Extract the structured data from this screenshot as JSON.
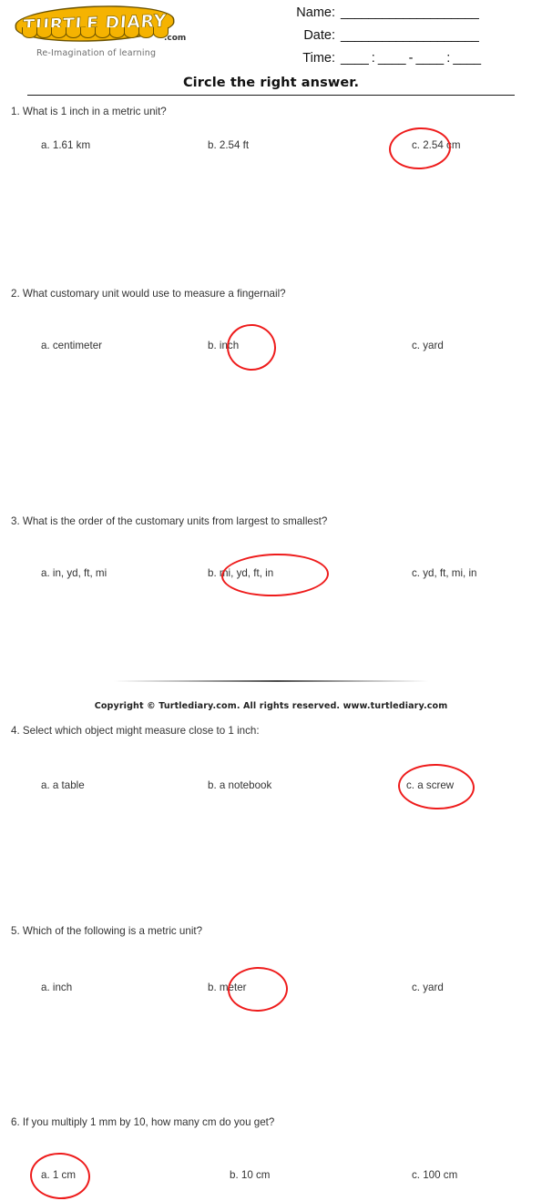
{
  "logo": {
    "wordmark": "TURTLE DIARY",
    "dotcom": ".com",
    "tagline": "Re-Imagination of learning",
    "color": "#F5B301"
  },
  "form": {
    "name_label": "Name:",
    "name_rule": "____________________",
    "date_label": "Date:",
    "date_rule": "____________________",
    "time_label": "Time:",
    "time_rule": "____ : ____ - ____ : ____"
  },
  "title": "Circle the right answer.",
  "annotation_color": "#ee1b1b",
  "questions": [
    {
      "text": "1. What is 1 inch in a metric unit?",
      "options": [
        {
          "label": "a. 1.61 km",
          "circled": false
        },
        {
          "label": "b. 2.54 ft",
          "circled": false
        },
        {
          "label": "c. 2.54 cm",
          "circled": true
        }
      ]
    },
    {
      "text": "2. What customary unit would use to measure a fingernail?",
      "options": [
        {
          "label": "a. centimeter",
          "circled": false
        },
        {
          "label": "b. inch",
          "circled": true
        },
        {
          "label": "c. yard",
          "circled": false
        }
      ]
    },
    {
      "text": "3. What is the order of the customary units from largest to smallest?",
      "options": [
        {
          "label": "a. in, yd, ft, mi",
          "circled": false
        },
        {
          "label": "b. mi, yd, ft, in",
          "circled": true
        },
        {
          "label": "c. yd, ft, mi, in",
          "circled": false
        }
      ]
    },
    {
      "text": "4. Select which object might measure close to 1 inch:",
      "options": [
        {
          "label": "a. a table",
          "circled": false
        },
        {
          "label": "b. a notebook",
          "circled": false
        },
        {
          "label": "c. a screw",
          "circled": true
        }
      ]
    },
    {
      "text": "5. Which of the following is a metric unit?",
      "options": [
        {
          "label": "a. inch",
          "circled": false
        },
        {
          "label": "b. meter",
          "circled": true
        },
        {
          "label": "c. yard",
          "circled": false
        }
      ]
    },
    {
      "text": "6. If you multiply 1 mm by 10, how many cm do you get?",
      "options": [
        {
          "label": "a. 1 cm",
          "circled": true
        },
        {
          "label": "b. 10 cm",
          "circled": false
        },
        {
          "label": "c. 100 cm",
          "circled": false
        }
      ]
    }
  ],
  "footer": "Copyright © Turtlediary.com. All rights reserved. www.turtlediary.com"
}
